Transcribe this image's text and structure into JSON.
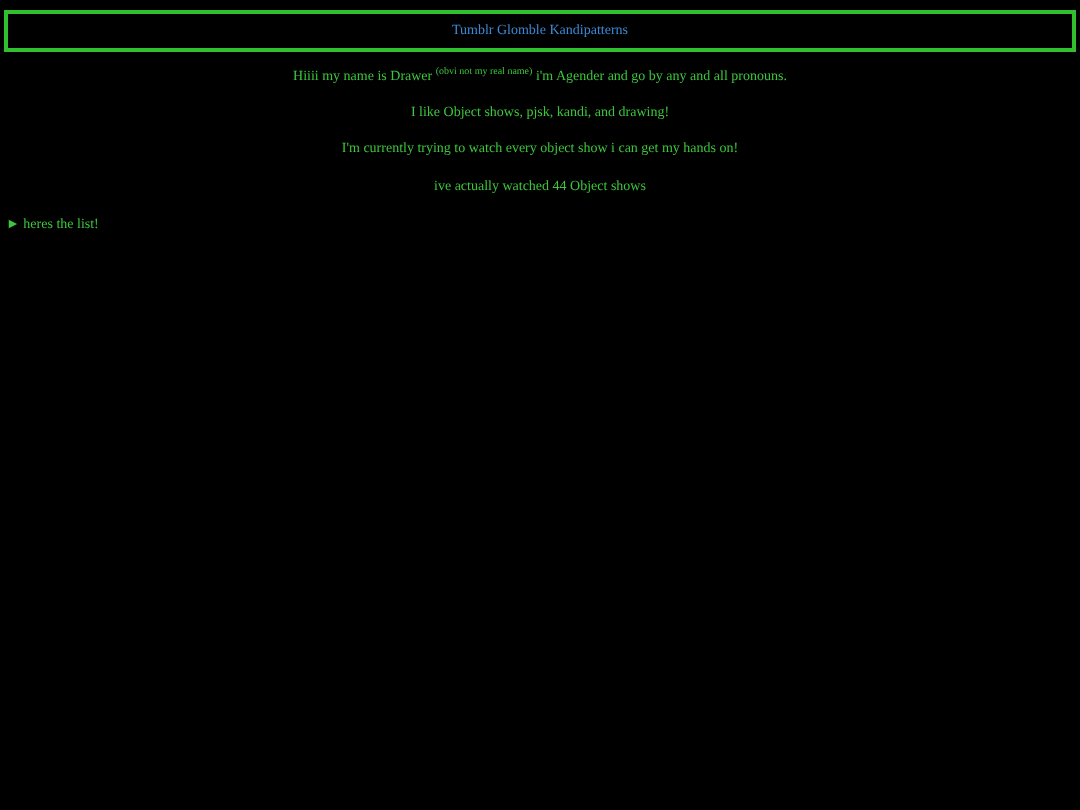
{
  "header": {
    "title": "Tumblr Glomble Kandipatterns"
  },
  "paragraphs": [
    "Hiiii my name is Drawer $^{(obvi not my real name)}$ i'm Agender and go by any and all pronouns.",
    "I like Object shows, pjsk, kandi, and drawing!",
    "I'm currently trying to watch every object show i can get my hands on!",
    "ive actually watched 44 Object shows"
  ],
  "disclosure": {
    "marker": "►",
    "label": "heres the list!",
    "expanded": false
  }
}
